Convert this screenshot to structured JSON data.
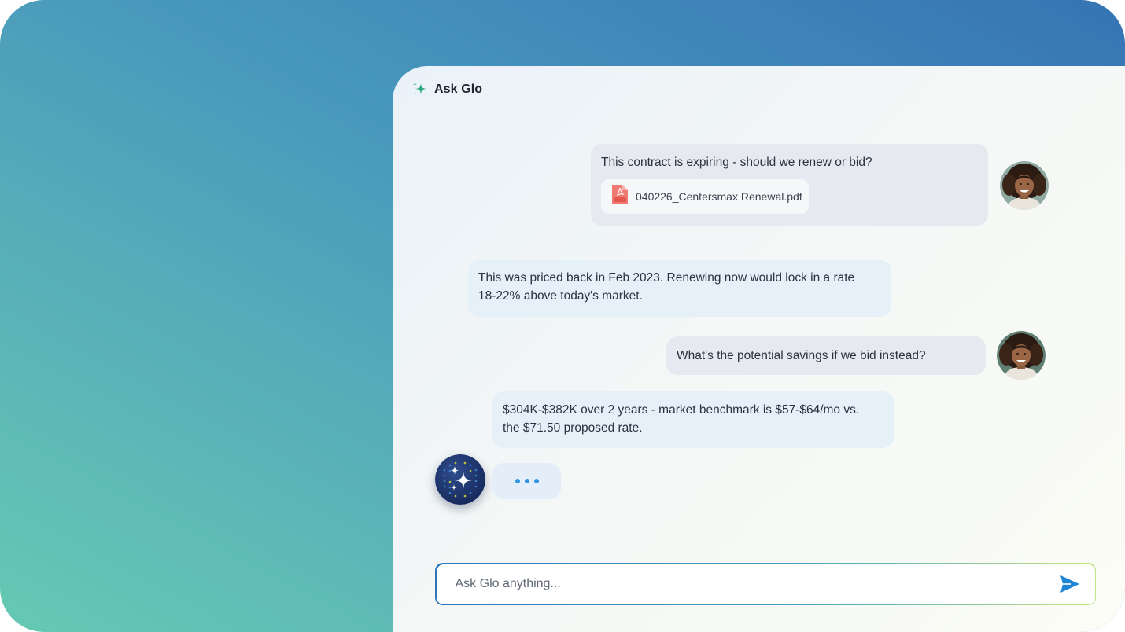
{
  "header": {
    "title": "Ask Glo",
    "icon": "sparkle-icon"
  },
  "messages": [
    {
      "role": "user",
      "text": "This contract is expiring - should we renew or bid?",
      "attachment": {
        "icon": "pdf-file-icon",
        "name": "040226_Centersmax Renewal.pdf"
      }
    },
    {
      "role": "assistant",
      "lines": [
        "This was priced back in Feb 2023. Renewing now would lock in a rate",
        "18-22% above today's market."
      ]
    },
    {
      "role": "user",
      "text": "What's the potential savings if we bid instead?"
    },
    {
      "role": "assistant",
      "lines": [
        "$304K-$382K over 2 years - market benchmark is $57-$64/mo vs.",
        "the $71.50 proposed rate."
      ]
    }
  ],
  "typing_indicator": {
    "icon": "typing-dots-icon"
  },
  "input": {
    "placeholder": "Ask Glo anything...",
    "value": "",
    "send_icon": "send-icon"
  },
  "colors": {
    "accent": "#2b97e0",
    "user_bubble": "#e6e9ef",
    "assistant_bubble": "#e5f0f9",
    "brand_dark": "#1e3466"
  }
}
